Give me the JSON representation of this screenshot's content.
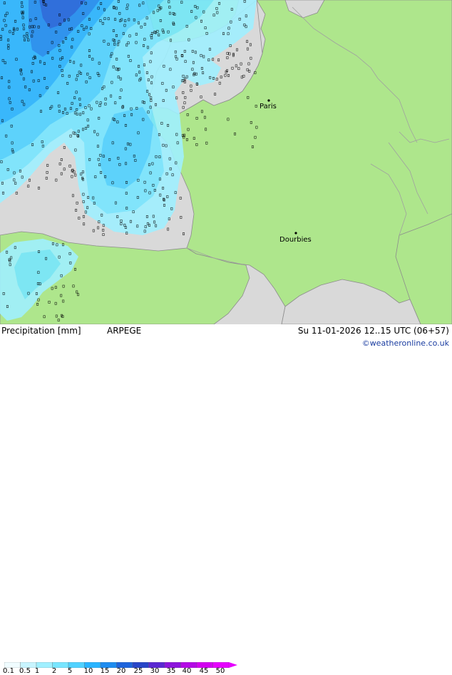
{
  "colors": {
    "sea": "#d9d9d9",
    "land": "#aee68c",
    "coast": "#8c8c8c",
    "border": "#a0a0a0",
    "precip_light": "#a0f0ff",
    "precip_mid": "#5ad2ff",
    "precip_strong": "#1e8cff",
    "precip_heavy": "#3c50dc"
  },
  "cities": [
    {
      "name": "Paris"
    },
    {
      "name": "Dourbies"
    }
  ],
  "footer": {
    "title": "Precipitation [mm]",
    "model": "ARPEGE",
    "datetime": "Su 11-01-2026 12..15 UTC (06+57)",
    "credit": "©weatheronline.co.uk"
  },
  "legend": {
    "ticks": [
      "0.1",
      "0.5",
      "1",
      "2",
      "5",
      "10",
      "15",
      "20",
      "25",
      "30",
      "35",
      "40",
      "45",
      "50"
    ],
    "colors": [
      "#f0fcff",
      "#c8f5ff",
      "#a0f0ff",
      "#78e6ff",
      "#50d2ff",
      "#28b4ff",
      "#1e8cf0",
      "#1e64dc",
      "#2846c8",
      "#5a28d2",
      "#8c14dc",
      "#b40ae6",
      "#d200f0",
      "#e600ff"
    ]
  }
}
